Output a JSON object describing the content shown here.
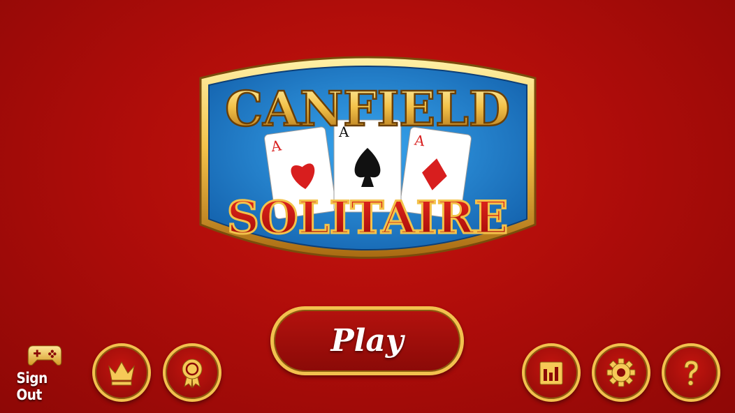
{
  "logo": {
    "title_top": "CANFIELD",
    "title_bottom": "SOLITAIRE",
    "card_rank": "A"
  },
  "play_button": {
    "label": "Play"
  },
  "sign_out": {
    "label": "Sign Out",
    "icon": "gamepad-icon"
  },
  "buttons": [
    {
      "name": "leaderboard-button",
      "icon": "crown-icon"
    },
    {
      "name": "achievements-button",
      "icon": "ribbon-award-icon"
    },
    {
      "name": "statistics-button",
      "icon": "bar-chart-icon"
    },
    {
      "name": "settings-button",
      "icon": "gear-icon"
    },
    {
      "name": "help-button",
      "icon": "question-mark-icon"
    }
  ],
  "colors": {
    "background": "#b00d0a",
    "gold": "#f2c14e",
    "banner_blue": "#1f7fd0"
  }
}
